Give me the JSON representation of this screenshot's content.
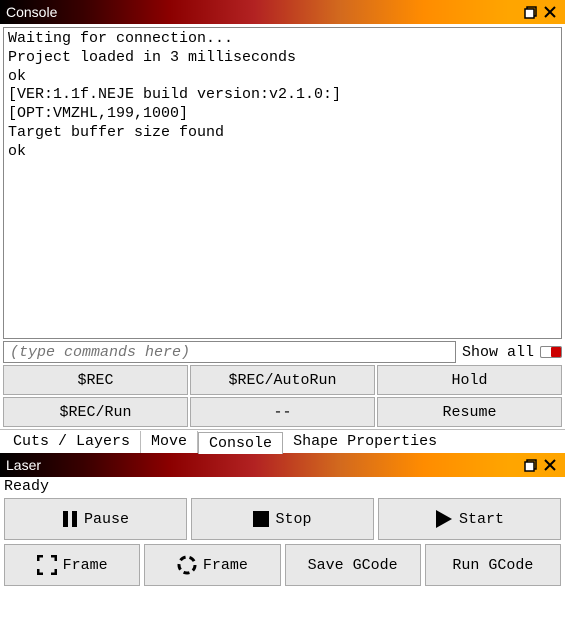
{
  "console": {
    "title": "Console",
    "output": "Waiting for connection...\nProject loaded in 3 milliseconds\nok\n[VER:1.1f.NEJE build version:v2.1.0:]\n[OPT:VMZHL,199,1000]\nTarget buffer size found\nok",
    "placeholder": "(type commands here)",
    "showall_label": "Show all",
    "buttons": {
      "rec": "$REC",
      "rec_autorun": "$REC/AutoRun",
      "hold": "Hold",
      "rec_run": "$REC/Run",
      "dash": "--",
      "resume": "Resume"
    }
  },
  "tabs": {
    "cuts": "Cuts / Layers",
    "move": "Move",
    "console": "Console",
    "shape": "Shape Properties"
  },
  "laser": {
    "title": "Laser",
    "status": "Ready",
    "buttons": {
      "pause": "Pause",
      "stop": "Stop",
      "start": "Start",
      "frame_sq": "Frame",
      "frame_circ": "Frame",
      "save_gcode": "Save GCode",
      "run_gcode": "Run GCode"
    }
  }
}
